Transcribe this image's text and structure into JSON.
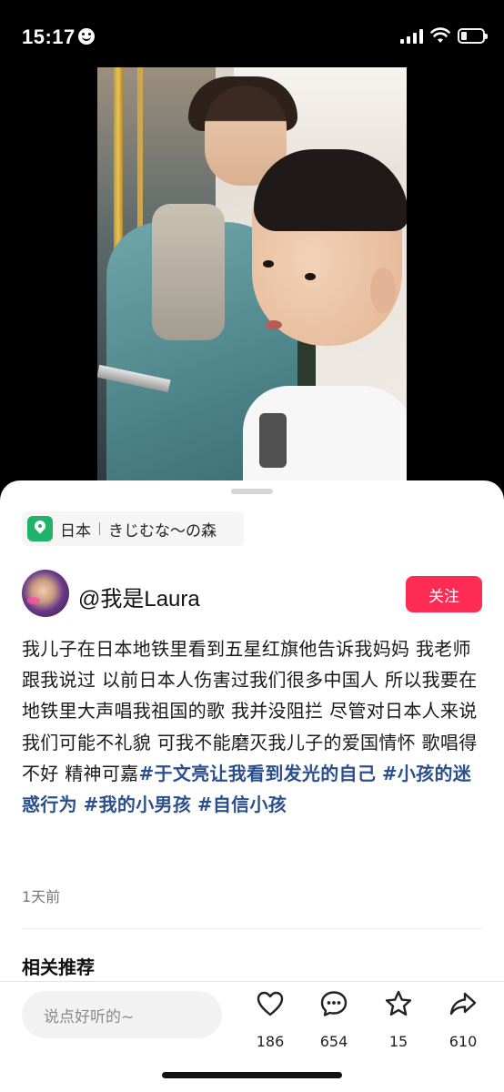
{
  "status_bar": {
    "time": "15:17"
  },
  "location": {
    "country": "日本",
    "place": "きじむな～の森"
  },
  "author": {
    "username": "@我是Laura",
    "follow_label": "关注"
  },
  "post": {
    "caption_text": "我儿子在日本地铁里看到五星红旗他告诉我妈妈 我老师跟我说过 以前日本人伤害过我们很多中国人 所以我要在地铁里大声唱我祖国的歌 我并没阻拦 尽管对日本人来说我们可能不礼貌 可我不能磨灭我儿子的爱国情怀 歌唱得不好 精神可嘉",
    "hashtags": [
      "#于文亮让我看到发光的自己",
      "#小孩的迷惑行为",
      "#我的小男孩",
      "#自信小孩"
    ],
    "time_ago": "1天前"
  },
  "related": {
    "title": "相关推荐"
  },
  "bottom_bar": {
    "comment_placeholder": "说点好听的~",
    "likes": "186",
    "comments": "654",
    "favorites": "15",
    "shares": "610"
  },
  "colors": {
    "follow_button": "#fe2c55",
    "hashtag": "#2b4f8c",
    "location_pin": "#22b36b"
  },
  "icons": [
    "smile-icon",
    "signal-icon",
    "wifi-icon",
    "battery-icon",
    "location-pin-icon",
    "heart-icon",
    "comment-icon",
    "star-icon",
    "share-icon"
  ]
}
